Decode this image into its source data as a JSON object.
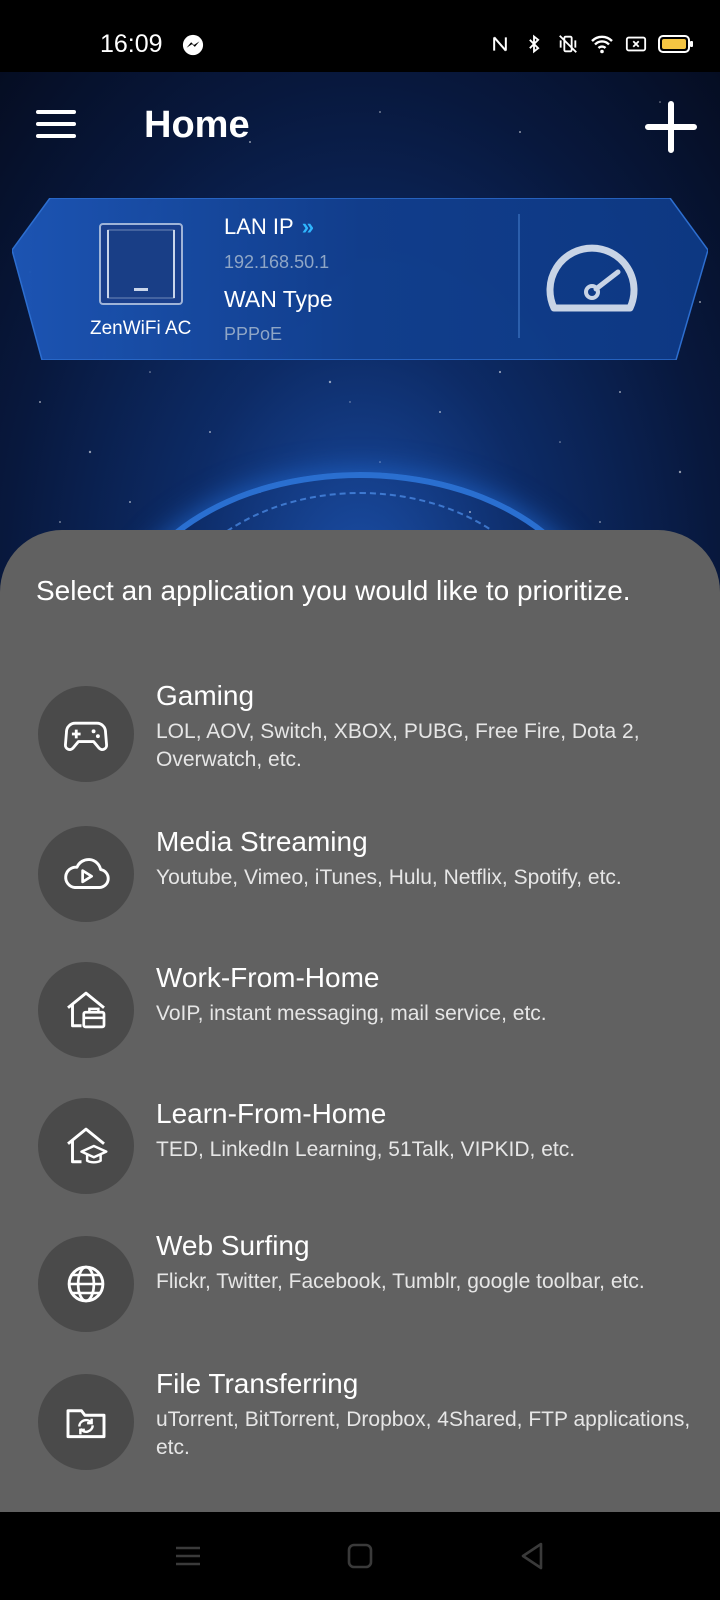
{
  "status_bar": {
    "time": "16:09",
    "left_icon": "messenger-icon",
    "right_icons": [
      "nfc-icon",
      "bluetooth-icon",
      "vibrate-icon",
      "wifi-icon",
      "close-box-icon",
      "battery-icon"
    ],
    "battery_color": "#f5c542"
  },
  "header": {
    "title": "Home",
    "menu_icon": "hamburger-menu-icon",
    "add_icon": "plus-icon"
  },
  "router_card": {
    "device_name": "ZenWiFi AC",
    "lan_label": "LAN IP",
    "lan_arrows": "»",
    "lan_ip": "192.168.50.1",
    "wan_label": "WAN Type",
    "wan_type": "PPPoE",
    "speed_icon": "speedometer-icon",
    "accent": "#2fb6ff"
  },
  "sheet": {
    "title": "Select an application you would like to prioritize.",
    "items": [
      {
        "name": "Gaming",
        "desc": "LOL, AOV, Switch, XBOX, PUBG, Free Fire, Dota 2, Overwatch, etc.",
        "icon": "gamepad-icon"
      },
      {
        "name": "Media Streaming",
        "desc": "Youtube, Vimeo, iTunes, Hulu, Netflix, Spotify, etc.",
        "icon": "cloud-play-icon"
      },
      {
        "name": "Work-From-Home",
        "desc": "VoIP, instant messaging, mail service, etc.",
        "icon": "home-briefcase-icon"
      },
      {
        "name": "Learn-From-Home",
        "desc": "TED, LinkedIn Learning, 51Talk, VIPKID, etc.",
        "icon": "home-graduation-icon"
      },
      {
        "name": "Web Surfing",
        "desc": "Flickr, Twitter, Facebook, Tumblr, google toolbar, etc.",
        "icon": "globe-icon"
      },
      {
        "name": "File Transferring",
        "desc": "uTorrent, BitTorrent, Dropbox, 4Shared, FTP applications, etc.",
        "icon": "folder-sync-icon"
      }
    ]
  },
  "nav_bar": {
    "buttons": [
      "recent-apps-icon",
      "home-icon",
      "back-icon"
    ]
  }
}
